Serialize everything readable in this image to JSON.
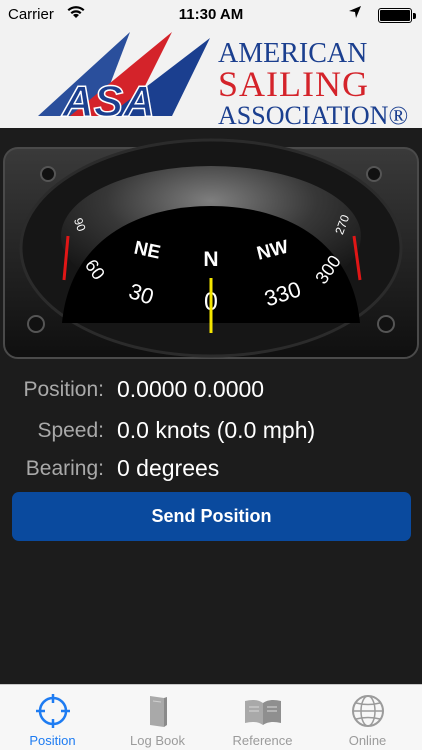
{
  "status_bar": {
    "carrier": "Carrier",
    "time": "11:30 AM"
  },
  "header": {
    "logo_initials": "ASA",
    "logo_line1": "AMERICAN",
    "logo_line2": "SAILING",
    "logo_line3": "ASSOCIATION®",
    "colors": {
      "blue": "#1b3f8f",
      "red": "#d4232a"
    }
  },
  "compass": {
    "labels": [
      "NE",
      "N",
      "NW"
    ],
    "numbers": [
      "60",
      "30",
      "0",
      "330",
      "300"
    ],
    "edge_labels": [
      "90",
      "270"
    ],
    "heading_degrees": 0
  },
  "info": {
    "position_label": "Position:",
    "position_value": "0.0000 0.0000",
    "speed_label": "Speed:",
    "speed_value": "0.0 knots (0.0 mph)",
    "bearing_label": "Bearing:",
    "bearing_value": "0 degrees"
  },
  "send_button": {
    "label": "Send Position",
    "color": "#0a4a9e"
  },
  "tabs": [
    {
      "label": "Position",
      "icon": "crosshair-icon",
      "active": true
    },
    {
      "label": "Log Book",
      "icon": "book-icon",
      "active": false
    },
    {
      "label": "Reference",
      "icon": "open-book-icon",
      "active": false
    },
    {
      "label": "Online",
      "icon": "globe-icon",
      "active": false
    }
  ],
  "accent_color": "#1e7cf2"
}
